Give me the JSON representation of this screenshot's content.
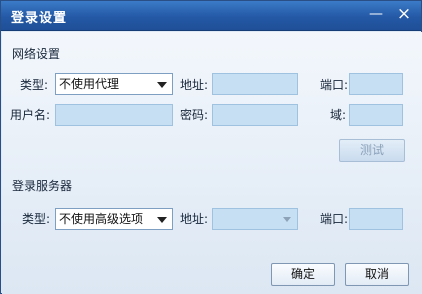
{
  "window": {
    "title": "登录设置",
    "minimize_glyph": "—",
    "close_glyph": "×"
  },
  "network": {
    "section_title": "网络设置",
    "type_label": "类型:",
    "type_value": "不使用代理",
    "address_label": "地址:",
    "address_value": "",
    "port_label": "端口:",
    "port_value": "",
    "username_label": "用户名:",
    "username_value": "",
    "password_label": "密码:",
    "password_value": "",
    "domain_label": "域:",
    "domain_value": "",
    "test_button": "测试"
  },
  "server": {
    "section_title": "登录服务器",
    "type_label": "类型:",
    "type_value": "不使用高级选项",
    "address_label": "地址:",
    "address_value": "",
    "port_label": "端口:",
    "port_value": ""
  },
  "footer": {
    "ok_button": "确定",
    "cancel_button": "取消"
  },
  "icons": {
    "dropdown": "chevron-down-icon",
    "minimize": "minimize-icon",
    "close": "close-icon"
  }
}
